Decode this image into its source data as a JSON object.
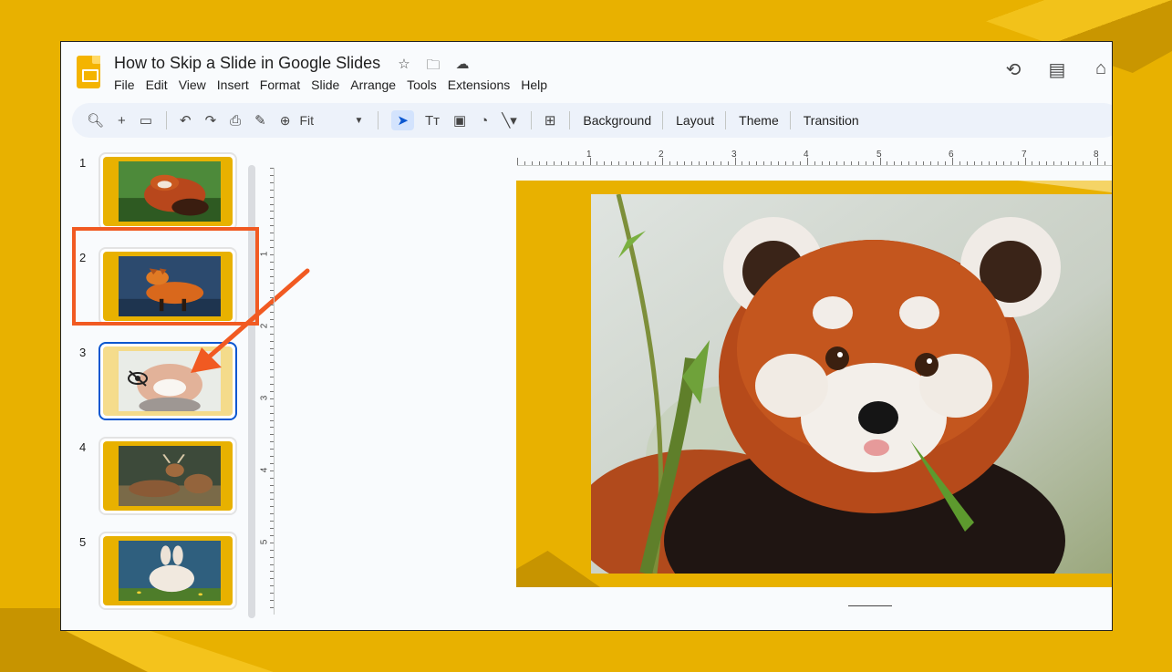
{
  "colors": {
    "background": "#e8b100",
    "accent": "#0b57d0",
    "highlight": "#f15a22"
  },
  "header": {
    "title": "How to Skip a Slide in Google Slides",
    "title_icons": [
      "star-icon",
      "move-to-folder-icon",
      "cloud-status-icon"
    ],
    "right_icons": [
      "version-history-icon",
      "comments-icon"
    ]
  },
  "menu": {
    "items": [
      "File",
      "Edit",
      "View",
      "Insert",
      "Format",
      "Slide",
      "Arrange",
      "Tools",
      "Extensions",
      "Help"
    ]
  },
  "toolbar": {
    "zoom": "Fit",
    "buttons": [
      "Background",
      "Layout",
      "Theme",
      "Transition"
    ]
  },
  "slides": [
    {
      "number": "1",
      "subject": "red panda"
    },
    {
      "number": "2",
      "subject": "fox"
    },
    {
      "number": "3",
      "subject": "red panda",
      "skipped": true,
      "selected": true
    },
    {
      "number": "4",
      "subject": "deer"
    },
    {
      "number": "5",
      "subject": "rabbit"
    }
  ],
  "ruler": {
    "horizontal": [
      "1",
      "2",
      "3",
      "4",
      "5",
      "6",
      "7",
      "8"
    ],
    "vertical": [
      "1",
      "2",
      "3",
      "4",
      "5"
    ]
  }
}
